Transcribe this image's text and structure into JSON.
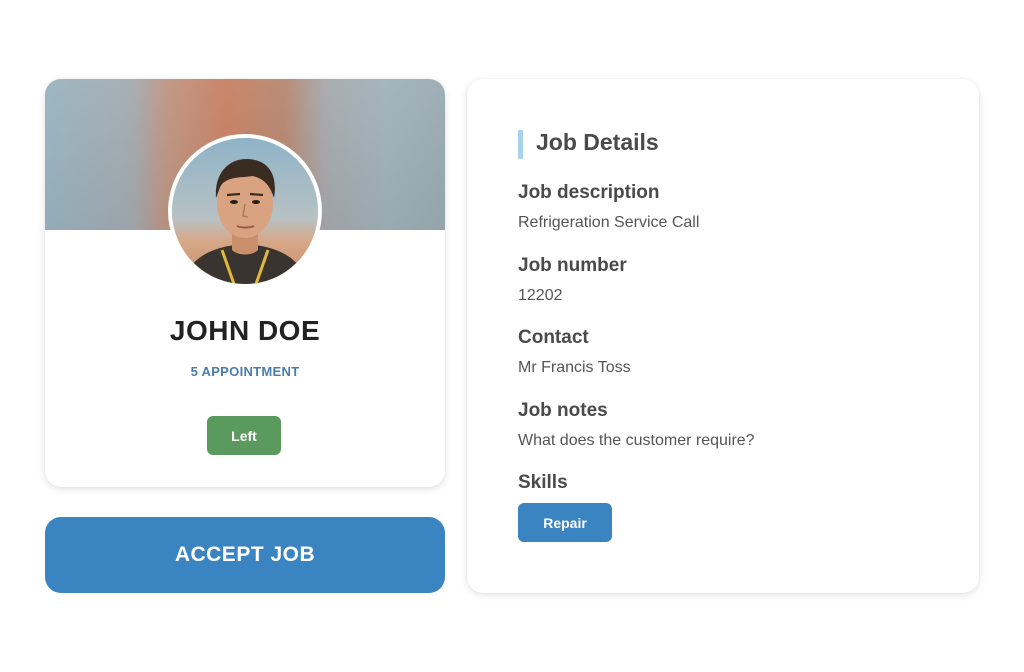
{
  "profile": {
    "name": "JOHN DOE",
    "appointments": "5 APPOINTMENT",
    "status_badge": "Left"
  },
  "actions": {
    "accept_label": "ACCEPT JOB"
  },
  "details": {
    "title": "Job Details",
    "fields": [
      {
        "label": "Job description",
        "value": "Refrigeration Service Call"
      },
      {
        "label": "Job number",
        "value": "12202"
      },
      {
        "label": "Contact",
        "value": "Mr Francis Toss"
      },
      {
        "label": "Job notes",
        "value": "What does the customer require?"
      }
    ],
    "skills_label": "Skills",
    "skills": [
      "Repair"
    ]
  },
  "colors": {
    "accent_blue": "#3a84c2",
    "status_green": "#5a9a5e",
    "appointment_text": "#4a7cad",
    "title_accent_bar": "#a9d1ec"
  },
  "icons": {
    "avatar": "user-photo"
  }
}
